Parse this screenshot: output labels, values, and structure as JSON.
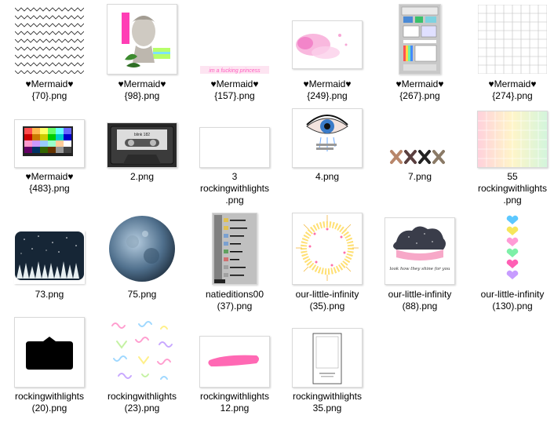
{
  "files": [
    {
      "id": "f1",
      "label": "♥Mermaid♥\n{70}.png",
      "thumb": "zigzag-pattern"
    },
    {
      "id": "f2",
      "label": "♥Mermaid♥\n{98}.png",
      "thumb": "vaporwave-statue"
    },
    {
      "id": "f3",
      "label": "♥Mermaid♥\n{157}.png",
      "thumb": "pink-text-banner",
      "thumb_text": "im a fucking princess"
    },
    {
      "id": "f4",
      "label": "♥Mermaid♥\n{249}.png",
      "thumb": "pink-watercolor"
    },
    {
      "id": "f5",
      "label": "♥Mermaid♥\n{267}.png",
      "thumb": "retro-desktop"
    },
    {
      "id": "f6",
      "label": "♥Mermaid♥\n{274}.png",
      "thumb": "grid-paper"
    },
    {
      "id": "f7",
      "label": "♥Mermaid♥\n{483}.png",
      "thumb": "color-palette"
    },
    {
      "id": "f8",
      "label": "2.png",
      "thumb": "cassette-tape",
      "thumb_text": "blink 182"
    },
    {
      "id": "f9",
      "label": "3\nrockingwithlights\n.png",
      "thumb": "blank-white"
    },
    {
      "id": "f10",
      "label": "4.png",
      "thumb": "crying-eye"
    },
    {
      "id": "f11",
      "label": "7.png",
      "thumb": "xxxx-marks"
    },
    {
      "id": "f12",
      "label": "55\nrockingwithlights\n.png",
      "thumb": "pastel-gradient-grid"
    },
    {
      "id": "f13",
      "label": "73.png",
      "thumb": "night-sky-trees"
    },
    {
      "id": "f14",
      "label": "75.png",
      "thumb": "blue-moon"
    },
    {
      "id": "f15",
      "label": "natieditions00\n(37).png",
      "thumb": "windows-start-menu"
    },
    {
      "id": "f16",
      "label": "our-little-infinity\n(35).png",
      "thumb": "sun-ring"
    },
    {
      "id": "f17",
      "label": "our-little-infinity\n(88).png",
      "thumb": "galaxy-cloud",
      "thumb_text": "look how they shine for you"
    },
    {
      "id": "f18",
      "label": "our-little-infinity\n(130).png",
      "thumb": "pastel-hearts"
    },
    {
      "id": "f19",
      "label": "rockingwithlights\n(20).png",
      "thumb": "black-speech-bubble"
    },
    {
      "id": "f20",
      "label": "rockingwithlights\n(23).png",
      "thumb": "pastel-squiggles"
    },
    {
      "id": "f21",
      "label": "rockingwithlights\n12.png",
      "thumb": "pink-brush-stroke"
    },
    {
      "id": "f22",
      "label": "rockingwithlights\n35.png",
      "thumb": "blank-document"
    }
  ]
}
